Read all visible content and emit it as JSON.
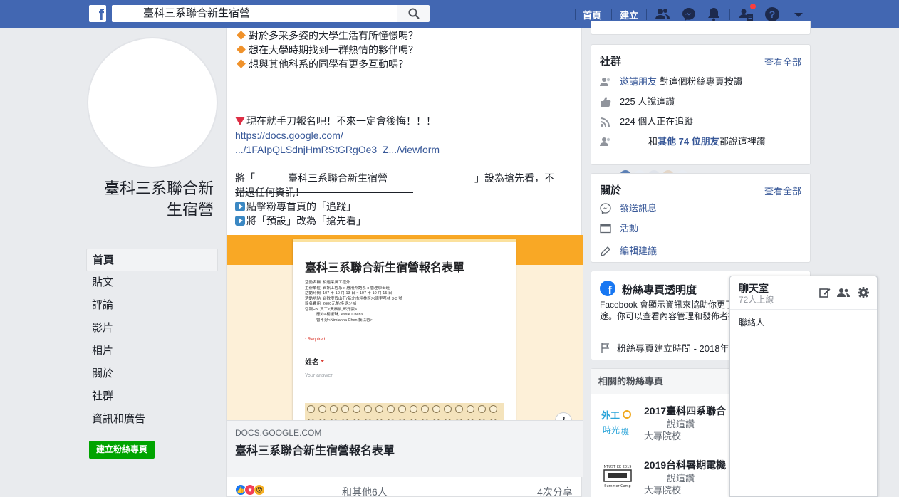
{
  "topbar": {
    "logo": "f",
    "search_value": "臺科三系聯合新生宿營",
    "nav_home": "首頁",
    "nav_create": "建立",
    "icons": [
      "friends-icon",
      "messenger-icon",
      "notifications-icon",
      "quick-help-icon",
      "help-icon",
      "dropdown-icon"
    ]
  },
  "page": {
    "name": "臺科三系聯合新生宿營"
  },
  "left_nav": {
    "items": [
      "首頁",
      "貼文",
      "評論",
      "影片",
      "相片",
      "關於",
      "社群",
      "資訊和廣告"
    ],
    "create_page": "建立粉絲專頁"
  },
  "post": {
    "lines": {
      "l1": "對於多采多姿的大學生活有所憧憬嗎？",
      "l2": "想在大學時期找到一群熱情的夥伴嗎？",
      "l3": "想與其他科系的同學有更多互動嗎？",
      "l4": "現在就手刀報名吧！不來一定會後悔！！！",
      "link1": "https://docs.google.com/",
      "link2": ".../1FAIpQLSdnjHmRStGRgOe3_Z.../viewform",
      "l5a": "將「",
      "l5b": "臺科三系聯合新生宿營—",
      "l5c": "」設為搶先看，不",
      "l6": "錯過任何資訊！",
      "l7": "點擊粉專首頁的「追蹤」",
      "l8": "將「預設」改為「搶先看」"
    },
    "form": {
      "title": "臺科三系聯合新生宿營報名表單",
      "desc": [
        "活動名稱: 相遇采風工程外",
        "主辦單位: 資訊工程系 x 應用外語系 x 管理學士班",
        "活動時間: 107 年 10 月 13 日 ~ 107 年 10 月 15 日",
        "活動地點: 台歡度假山莊(新北市坪林區水德里芎林 3-3 號",
        "報名費用: 2600元整(多退少補",
        "召報FB: 資工<黃泰凱,邱元豪>",
        "應外<楊淑琳,Jessie Chen>",
        "管不分<Nimianna Chen,龔以蓉>"
      ],
      "required": "* Required",
      "question": "姓名",
      "question_mark": "*",
      "answer_placeholder": "Your answer"
    },
    "link_domain": "DOCS.GOOGLE.COM",
    "link_title": "臺科三系聯合新生宿營報名表單",
    "reactions_text": "和其他6人",
    "shares": "4次分享"
  },
  "community": {
    "title": "社群",
    "see_all": "查看全部",
    "invite_link": "邀請朋友",
    "invite_rest": " 對這個粉絲專頁按讚",
    "likes": "225 人說這讚",
    "follows": "224 個人正在追蹤",
    "friends_a": "和",
    "friends_b": "其他 74 位朋友",
    "friends_c": "都說這裡讚"
  },
  "about": {
    "title": "關於",
    "see_all": "查看全部",
    "send_message": "發送訊息",
    "events": "活動",
    "suggest_edit": "編輯建議"
  },
  "transparency": {
    "title": "粉絲專頁透明度",
    "body": "Facebook 會顯示資訊來協助你更了解粉絲專頁的用途。你可以查看內容管理和發佈者採取的動作。",
    "created": "粉絲專頁建立時間 - 2018年"
  },
  "related": {
    "title": "相關的粉絲專頁",
    "pages": [
      {
        "name": "2017臺科四系聯合",
        "likes": "說這讚",
        "category": "大專院校"
      },
      {
        "name": "2019台科暑期電機",
        "likes": "說這讚",
        "category": "大專院校"
      }
    ]
  },
  "chat": {
    "title": "聊天室",
    "online": "72人上線",
    "contacts": "聯絡人"
  },
  "colors": {
    "topbar": "#4267b2",
    "link": "#385898",
    "create_page": "#00a400",
    "preview_band": "#f9a825"
  }
}
